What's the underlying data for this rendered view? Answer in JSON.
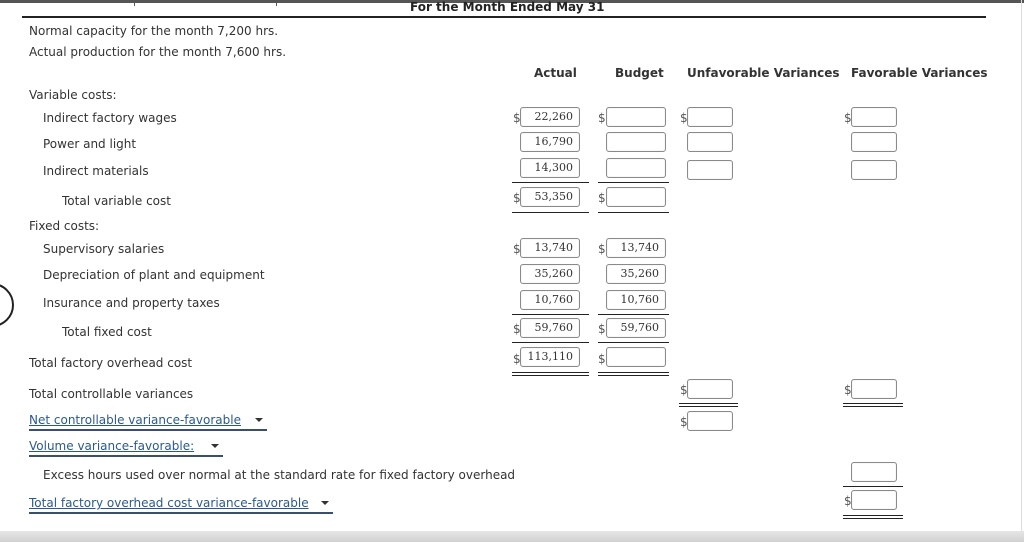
{
  "header": {
    "title": "For the Month Ended May 31",
    "normal_capacity": "Normal capacity for the month 7,200 hrs.",
    "actual_production": "Actual production for the month 7,600 hrs."
  },
  "columns": {
    "actual": "Actual",
    "budget": "Budget",
    "unfavorable": "Unfavorable Variances",
    "favorable": "Favorable Variances"
  },
  "currency": "$",
  "variable": {
    "heading": "Variable costs:",
    "rows": [
      {
        "label": "Indirect factory wages",
        "actual": "22,260",
        "budget": "",
        "unfavorable": "",
        "favorable": ""
      },
      {
        "label": "Power and light",
        "actual": "16,790",
        "budget": "",
        "unfavorable": "",
        "favorable": ""
      },
      {
        "label": "Indirect materials",
        "actual": "14,300",
        "budget": "",
        "unfavorable": "",
        "favorable": ""
      }
    ],
    "total": {
      "label": "Total variable cost",
      "actual": "53,350",
      "budget": ""
    }
  },
  "fixed": {
    "heading": "Fixed costs:",
    "rows": [
      {
        "label": "Supervisory salaries",
        "actual": "13,740",
        "budget": "13,740"
      },
      {
        "label": "Depreciation of plant and equipment",
        "actual": "35,260",
        "budget": "35,260"
      },
      {
        "label": "Insurance and property taxes",
        "actual": "10,760",
        "budget": "10,760"
      }
    ],
    "total": {
      "label": "Total fixed cost",
      "actual": "59,760",
      "budget": "59,760"
    }
  },
  "total_overhead": {
    "label": "Total factory overhead cost",
    "actual": "113,110",
    "budget": ""
  },
  "total_controllable": {
    "label": "Total controllable variances",
    "unfavorable": "",
    "favorable": ""
  },
  "net_controllable": {
    "selected": "Net controllable variance-favorable",
    "value": ""
  },
  "volume": {
    "selected": "Volume variance-favorable:"
  },
  "excess_hours": {
    "label": "Excess hours used over normal at the standard rate for fixed factory overhead",
    "value": ""
  },
  "total_variance": {
    "selected": "Total factory overhead cost variance-favorable",
    "value": ""
  }
}
